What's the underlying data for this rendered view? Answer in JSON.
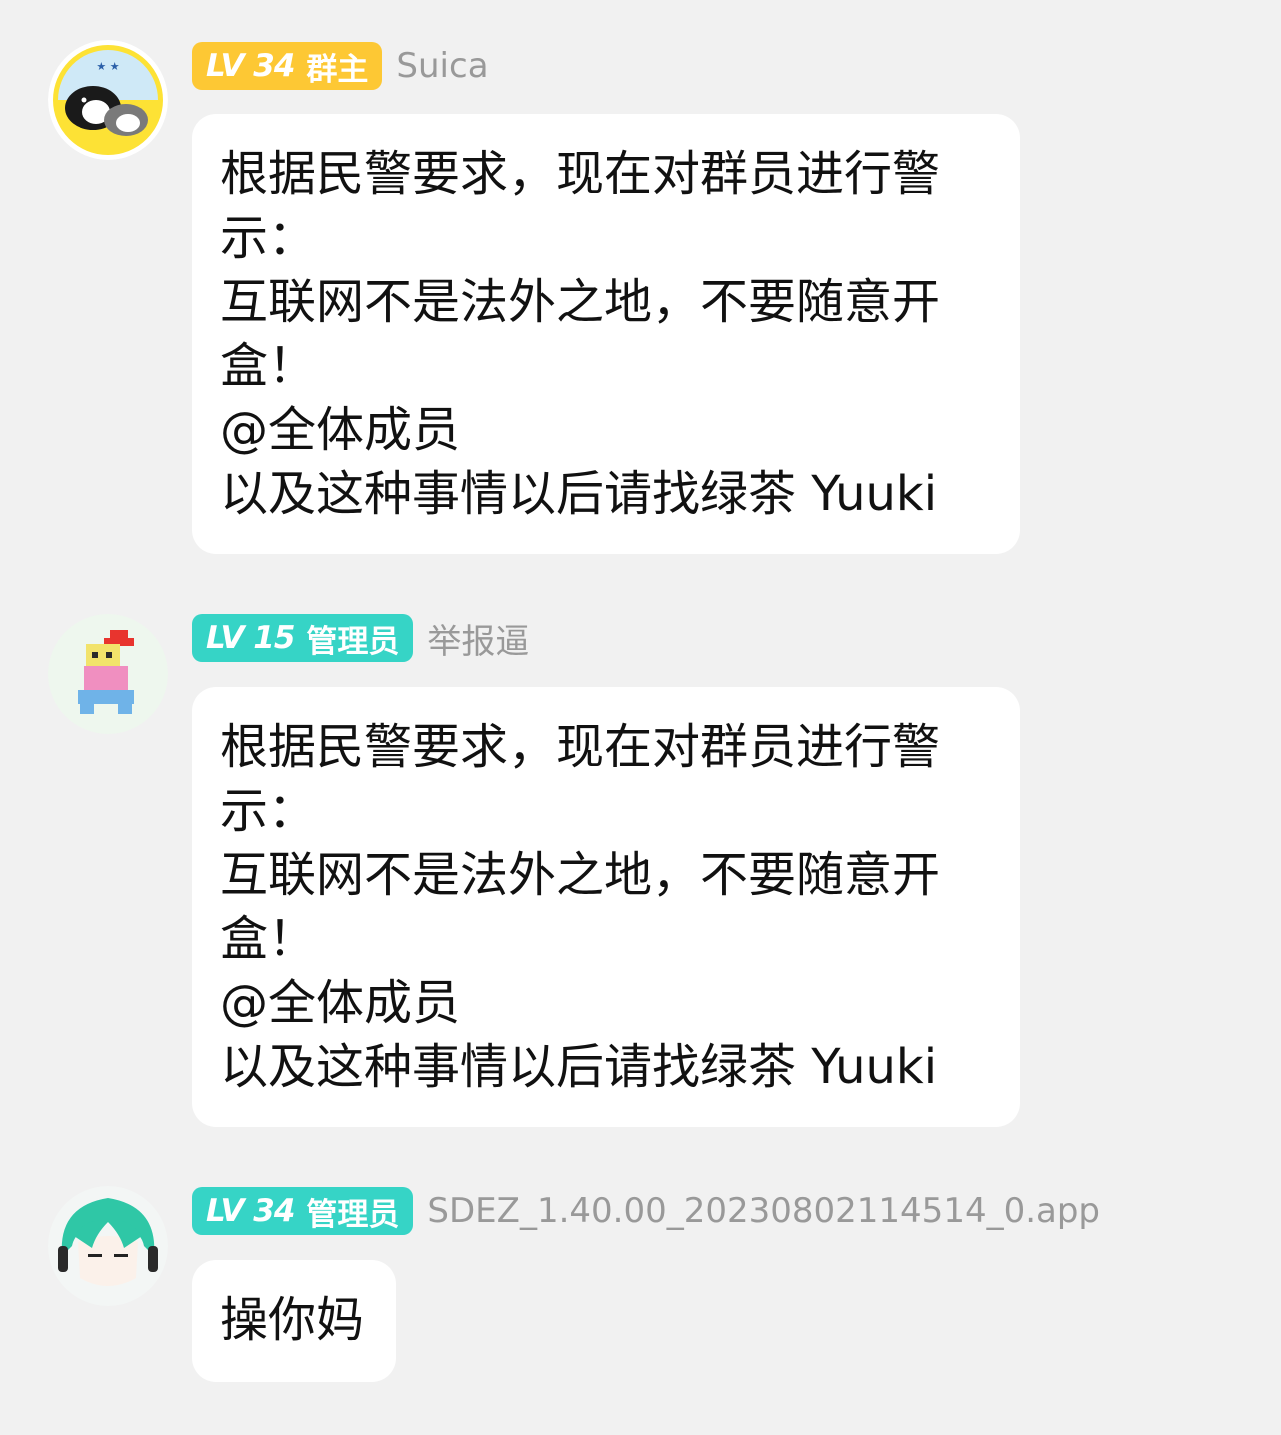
{
  "messages": [
    {
      "badge_level": "LV 34",
      "badge_role": "群主",
      "badge_color": "#fdc834",
      "sender": "Suica",
      "avatar": "penguin-avatar-icon",
      "lines": [
        "根据民警要求，现在对群员进行警",
        "示：",
        "互联网不是法外之地，不要随意开",
        "盒！",
        "@全体成员",
        "以及这种事情以后请找绿茶 Yuuki"
      ]
    },
    {
      "badge_level": "LV 15",
      "badge_role": "管理员",
      "badge_color": "#36d4c6",
      "sender": "举报逼",
      "avatar": "pixel-character-avatar-icon",
      "lines": [
        "根据民警要求，现在对群员进行警",
        "示：",
        "互联网不是法外之地，不要随意开",
        "盒！",
        "@全体成员",
        "以及这种事情以后请找绿茶 Yuuki"
      ]
    },
    {
      "badge_level": "LV 34",
      "badge_role": "管理员",
      "badge_color": "#36d4c6",
      "sender": "SDEZ_1.40.00_20230802114514_0.app",
      "avatar": "green-hair-anime-avatar-icon",
      "lines": [
        "操你妈"
      ]
    }
  ]
}
